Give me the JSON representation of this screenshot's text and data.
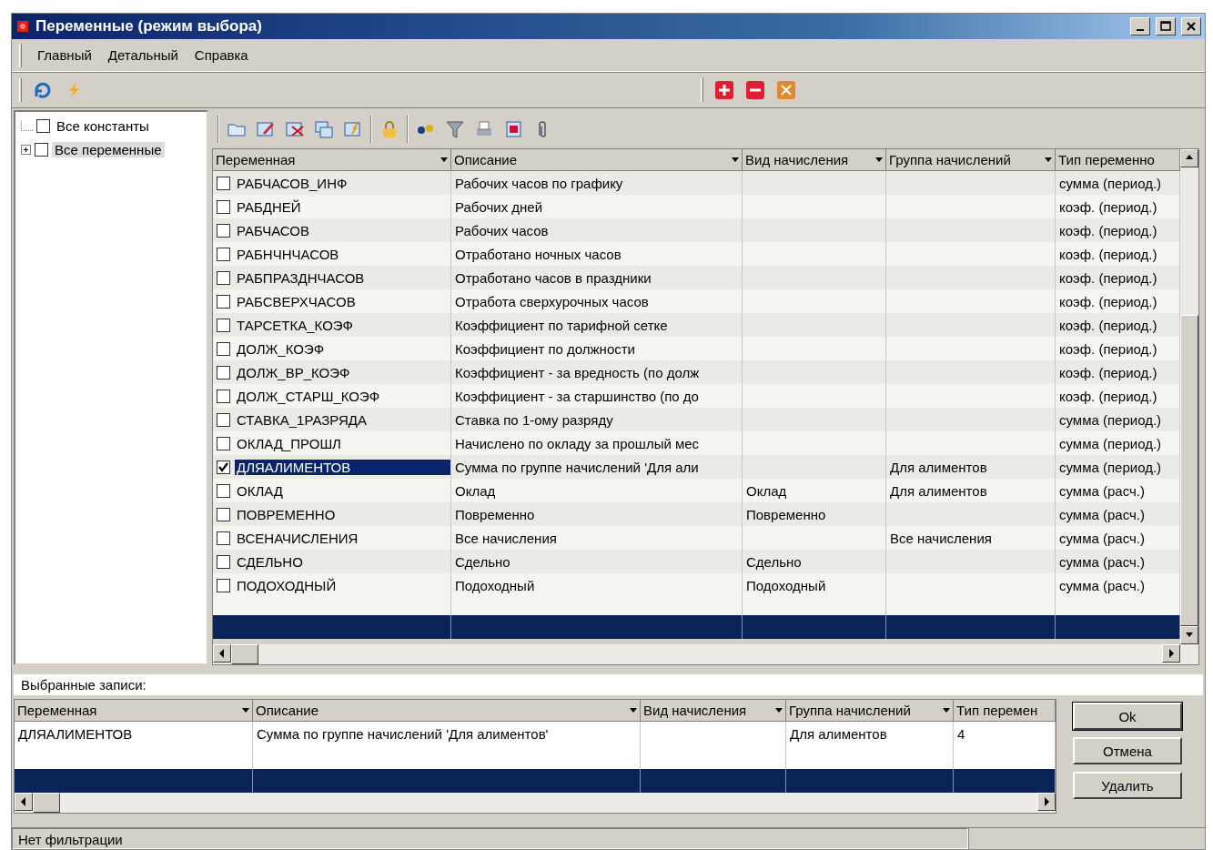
{
  "window": {
    "title": "Переменные (режим выбора)"
  },
  "menu": [
    "Главный",
    "Детальный",
    "Справка"
  ],
  "tree": [
    {
      "label": "Все константы",
      "kind": "leaf",
      "checked": false,
      "selected": false
    },
    {
      "label": "Все переменные",
      "kind": "branch",
      "expanded": false,
      "checked": false,
      "selected": true
    }
  ],
  "table": {
    "columns": [
      "Переменная",
      "Описание",
      "Вид начисления",
      "Группа начислений",
      "Тип переменно"
    ],
    "rows": [
      {
        "name": "РАБЧАСОВ_ИНФ",
        "checked": false,
        "selected": false,
        "description": "Рабочих часов по графику",
        "accrual_kind": "",
        "accrual_group": "",
        "type": "сумма (период.)"
      },
      {
        "name": "РАБДНЕЙ",
        "checked": false,
        "selected": false,
        "description": "Рабочих дней",
        "accrual_kind": "",
        "accrual_group": "",
        "type": "коэф. (период.)"
      },
      {
        "name": "РАБЧАСОВ",
        "checked": false,
        "selected": false,
        "description": "Рабочих часов",
        "accrual_kind": "",
        "accrual_group": "",
        "type": "коэф. (период.)"
      },
      {
        "name": "РАБНЧНЧАСОВ",
        "checked": false,
        "selected": false,
        "description": "Отработано ночных часов",
        "accrual_kind": "",
        "accrual_group": "",
        "type": "коэф. (период.)"
      },
      {
        "name": "РАБПРАЗДНЧАСОВ",
        "checked": false,
        "selected": false,
        "description": "Отработано часов в праздники",
        "accrual_kind": "",
        "accrual_group": "",
        "type": "коэф. (период.)"
      },
      {
        "name": "РАБСВЕРХЧАСОВ",
        "checked": false,
        "selected": false,
        "description": "Отработа сверхурочных часов",
        "accrual_kind": "",
        "accrual_group": "",
        "type": "коэф. (период.)"
      },
      {
        "name": "ТАРСЕТКА_КОЭФ",
        "checked": false,
        "selected": false,
        "description": "Коэффициент по тарифной сетке",
        "accrual_kind": "",
        "accrual_group": "",
        "type": "коэф. (период.)"
      },
      {
        "name": "ДОЛЖ_КОЭФ",
        "checked": false,
        "selected": false,
        "description": "Коэффициент по должности",
        "accrual_kind": "",
        "accrual_group": "",
        "type": "коэф. (период.)"
      },
      {
        "name": "ДОЛЖ_ВР_КОЭФ",
        "checked": false,
        "selected": false,
        "description": "Коэффициент - за вредность (по долж",
        "accrual_kind": "",
        "accrual_group": "",
        "type": "коэф. (период.)"
      },
      {
        "name": "ДОЛЖ_СТАРШ_КОЭФ",
        "checked": false,
        "selected": false,
        "description": "Коэффициент - за старшинство (по до",
        "accrual_kind": "",
        "accrual_group": "",
        "type": "коэф. (период.)"
      },
      {
        "name": "СТАВКА_1РАЗРЯДА",
        "checked": false,
        "selected": false,
        "description": "Ставка по 1-ому разряду",
        "accrual_kind": "",
        "accrual_group": "",
        "type": "сумма (период.)"
      },
      {
        "name": "ОКЛАД_ПРОШЛ",
        "checked": false,
        "selected": false,
        "description": "Начислено по окладу за прошлый мес",
        "accrual_kind": "",
        "accrual_group": "",
        "type": "сумма (период.)"
      },
      {
        "name": "ДЛЯАЛИМЕНТОВ",
        "checked": true,
        "selected": true,
        "description": "Сумма по группе начислений 'Для али",
        "accrual_kind": "",
        "accrual_group": "Для алиментов",
        "type": "сумма (период.)"
      },
      {
        "name": "ОКЛАД",
        "checked": false,
        "selected": false,
        "description": "Оклад",
        "accrual_kind": "Оклад",
        "accrual_group": "Для алиментов",
        "type": "сумма (расч.)"
      },
      {
        "name": "ПОВРЕМЕННО",
        "checked": false,
        "selected": false,
        "description": "Повременно",
        "accrual_kind": "Повременно",
        "accrual_group": "",
        "type": "сумма (расч.)"
      },
      {
        "name": "ВСЕНАЧИСЛЕНИЯ",
        "checked": false,
        "selected": false,
        "description": "Все начисления",
        "accrual_kind": "",
        "accrual_group": "Все начисления",
        "type": "сумма (расч.)"
      },
      {
        "name": "СДЕЛЬНО",
        "checked": false,
        "selected": false,
        "description": "Сдельно",
        "accrual_kind": "Сдельно",
        "accrual_group": "",
        "type": "сумма (расч.)"
      },
      {
        "name": "ПОДОХОДНЫЙ",
        "checked": false,
        "selected": false,
        "description": "Подоходный",
        "accrual_kind": "Подоходный",
        "accrual_group": "",
        "type": "сумма (расч.)"
      }
    ]
  },
  "selected_records": {
    "label": "Выбранные записи:",
    "columns": [
      "Переменная",
      "Описание",
      "Вид начисления",
      "Группа начислений",
      "Тип перемен"
    ],
    "rows": [
      {
        "name": "ДЛЯАЛИМЕНТОВ",
        "description": "Сумма по группе начислений 'Для алиментов'",
        "accrual_kind": "",
        "accrual_group": "Для алиментов",
        "type": "4"
      }
    ]
  },
  "buttons": [
    "Ok",
    "Отмена",
    "Удалить"
  ],
  "status_bar": "Нет фильтрации"
}
